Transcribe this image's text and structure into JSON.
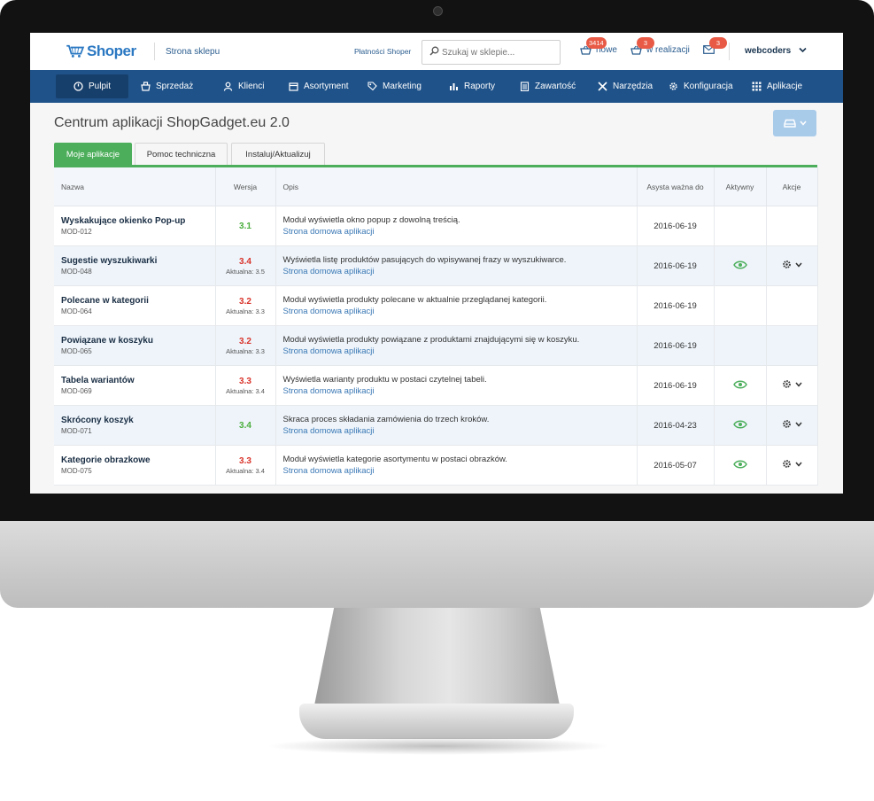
{
  "header": {
    "logo": "Shoper",
    "store_link": "Strona sklepu",
    "payments_link": "Płatności Shoper",
    "search_placeholder": "Szukaj w sklepie...",
    "notifications": [
      {
        "label": "nowe",
        "count": "3414",
        "icon": "basket-icon"
      },
      {
        "label": "w realizacji",
        "count": "3",
        "icon": "basket-icon"
      },
      {
        "label": "",
        "count": "3",
        "icon": "mail-icon"
      }
    ],
    "user": "webcoders"
  },
  "nav": [
    {
      "label": "Pulpit",
      "icon": "dashboard-icon",
      "active": true
    },
    {
      "label": "Sprzedaż",
      "icon": "cart-icon"
    },
    {
      "label": "Klienci",
      "icon": "users-icon"
    },
    {
      "label": "Asortyment",
      "icon": "box-icon"
    },
    {
      "label": "Marketing",
      "icon": "tag-icon"
    },
    {
      "label": "Raporty",
      "icon": "bar-chart-icon"
    },
    {
      "label": "Zawartość",
      "icon": "document-icon"
    },
    {
      "label": "Narzędzia",
      "icon": "tools-icon"
    },
    {
      "label": "Konfiguracja",
      "icon": "gear-icon"
    },
    {
      "label": "Aplikacje",
      "icon": "grid-icon"
    }
  ],
  "page": {
    "title": "Centrum aplikacji ShopGadget.eu 2.0",
    "tabs": [
      "Moje aplikacje",
      "Pomoc techniczna",
      "Instaluj/Aktualizuj"
    ],
    "active_tab": 0
  },
  "table": {
    "columns": [
      "Nazwa",
      "Wersja",
      "Opis",
      "Asysta ważna do",
      "Aktywny",
      "Akcje"
    ],
    "rows": [
      {
        "name": "Wyskakujące okienko Pop-up",
        "code": "MOD-012",
        "version": "3.1",
        "current": "",
        "outdated": false,
        "desc": "Moduł wyświetla okno popup z dowolną treścią.",
        "home": "Strona domowa aplikacji",
        "date": "2016-06-19",
        "active": false,
        "actions": false
      },
      {
        "name": "Sugestie wyszukiwarki",
        "code": "MOD-048",
        "version": "3.4",
        "current": "Aktualna: 3.5",
        "outdated": true,
        "desc": "Wyświetla listę produktów pasujących do wpisywanej frazy w wyszukiwarce.",
        "home": "Strona domowa aplikacji",
        "date": "2016-06-19",
        "active": true,
        "actions": true
      },
      {
        "name": "Polecane w kategorii",
        "code": "MOD-064",
        "version": "3.2",
        "current": "Aktualna: 3.3",
        "outdated": true,
        "desc": "Moduł wyświetla produkty polecane w aktualnie przeglądanej kategorii.",
        "home": "Strona domowa aplikacji",
        "date": "2016-06-19",
        "active": false,
        "actions": false
      },
      {
        "name": "Powiązane w koszyku",
        "code": "MOD-065",
        "version": "3.2",
        "current": "Aktualna: 3.3",
        "outdated": true,
        "desc": "Moduł wyświetla produkty powiązane z produktami znajdującymi się w koszyku.",
        "home": "Strona domowa aplikacji",
        "date": "2016-06-19",
        "active": false,
        "actions": false
      },
      {
        "name": "Tabela wariantów",
        "code": "MOD-069",
        "version": "3.3",
        "current": "Aktualna: 3.4",
        "outdated": true,
        "desc": "Wyświetla warianty produktu w postaci czytelnej tabeli.",
        "home": "Strona domowa aplikacji",
        "date": "2016-06-19",
        "active": true,
        "actions": true
      },
      {
        "name": "Skrócony koszyk",
        "code": "MOD-071",
        "version": "3.4",
        "current": "",
        "outdated": false,
        "desc": "Skraca proces składania zamówienia do trzech kroków.",
        "home": "Strona domowa aplikacji",
        "date": "2016-04-23",
        "active": true,
        "actions": true
      },
      {
        "name": "Kategorie obrazkowe",
        "code": "MOD-075",
        "version": "3.3",
        "current": "Aktualna: 3.4",
        "outdated": true,
        "desc": "Moduł wyświetla kategorie asortymentu w postaci obrazków.",
        "home": "Strona domowa aplikacji",
        "date": "2016-05-07",
        "active": true,
        "actions": true
      }
    ]
  },
  "colors": {
    "nav": "#1f5289",
    "accent_green": "#4cae5b",
    "badge": "#e85a45",
    "outdated": "#d9342b",
    "up_to_date": "#4cae3f",
    "link": "#3a78b5"
  }
}
